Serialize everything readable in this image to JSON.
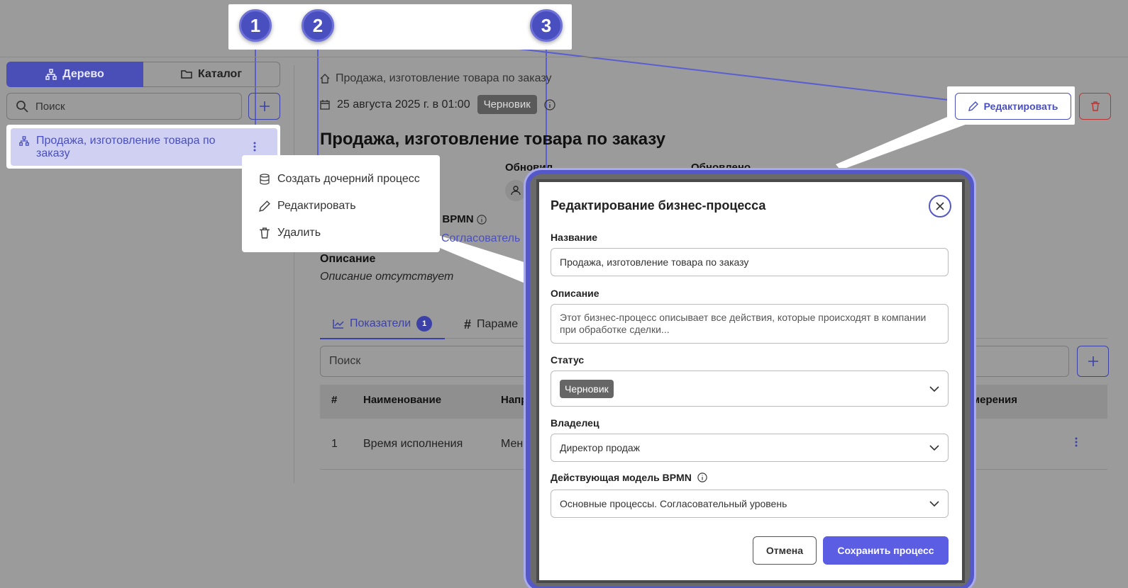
{
  "callouts": [
    "1",
    "2",
    "3"
  ],
  "sidebar": {
    "tab_tree": "Дерево",
    "tab_catalog": "Каталог",
    "search_placeholder": "Поиск",
    "tree_item": "Продажа, изготовление товара по заказу"
  },
  "context_menu": {
    "items": [
      {
        "label": "Создать дочерний процесс",
        "icon": "database-icon"
      },
      {
        "label": "Редактировать",
        "icon": "pencil-icon"
      },
      {
        "label": "Удалить",
        "icon": "trash-icon"
      }
    ]
  },
  "main": {
    "breadcrumb": "Продажа, изготовление товара по заказу",
    "date": "25 августа 2025 г. в 01:00",
    "status": "Черновик",
    "title": "Продажа, изготовление товара по заказу",
    "updated_by_label": "Обновил",
    "updated_at_label": "Обновлено",
    "bpmn_label": "ь BPMN",
    "bpmn_link": "Согласователь",
    "description_label": "Описание",
    "description_value": "Описание отсутствует",
    "tab_indicators": "Показатели",
    "tab_indicators_count": "1",
    "tab_params": "Параме",
    "search_placeholder": "Поиск",
    "edit_button": "Редактировать",
    "table": {
      "headers": [
        "#",
        "Наименование",
        "Напр",
        "мерения"
      ],
      "rows": [
        [
          "1",
          "Время исполнения",
          "Мен"
        ]
      ]
    }
  },
  "modal": {
    "title": "Редактирование бизнес-процесса",
    "name_label": "Название",
    "name_value": "Продажа, изготовление товара по заказу",
    "description_label": "Описание",
    "description_placeholder": "Этот бизнес-процесс описывает все действия, которые происходят в компании при обработке сделки...",
    "status_label": "Статус",
    "status_value": "Черновик",
    "owner_label": "Владелец",
    "owner_value": "Директор продаж",
    "bpmn_label": "Действующая модель BPMN",
    "bpmn_value": "Основные процессы. Согласовательный уровень",
    "cancel": "Отмена",
    "save": "Сохранить процесс"
  },
  "colors": {
    "accent": "#4a4fc0",
    "save": "#5b5ee3",
    "danger": "#b33333",
    "backdrop": "#9b9b9b"
  }
}
